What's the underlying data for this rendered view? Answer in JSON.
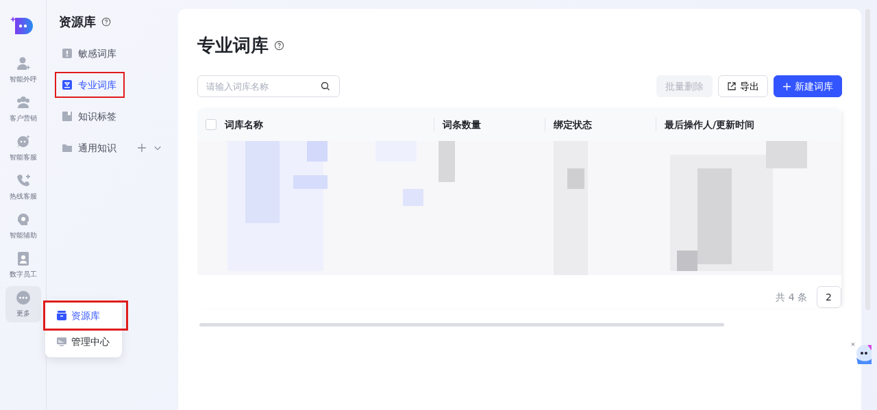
{
  "rail": {
    "items": [
      {
        "label": "智能外呼",
        "selected": false
      },
      {
        "label": "客户营销",
        "selected": false
      },
      {
        "label": "智能客服",
        "selected": false
      },
      {
        "label": "热线客服",
        "selected": false
      },
      {
        "label": "智能辅助",
        "selected": false
      },
      {
        "label": "数字员工",
        "selected": false
      },
      {
        "label": "更多",
        "selected": true
      }
    ]
  },
  "popup_menu": {
    "items": [
      {
        "label": "资源库",
        "selected": true,
        "highlighted": true
      },
      {
        "label": "管理中心",
        "selected": false,
        "highlighted": false
      }
    ]
  },
  "sidebar": {
    "title": "资源库",
    "items": [
      {
        "label": "敏感词库",
        "selected": false,
        "highlighted": false
      },
      {
        "label": "专业词库",
        "selected": true,
        "highlighted": true
      },
      {
        "label": "知识标签",
        "selected": false,
        "highlighted": false
      },
      {
        "label": "通用知识",
        "selected": false,
        "highlighted": false,
        "expandable": true
      }
    ]
  },
  "page": {
    "title": "专业词库",
    "search": {
      "placeholder": "请输入词库名称"
    },
    "buttons": [
      {
        "label": "批量删除",
        "kind": "disabled"
      },
      {
        "label": "导出",
        "kind": "export"
      },
      {
        "label": "新建词库",
        "kind": "primary"
      }
    ],
    "table": {
      "select_all": {
        "checked": false
      },
      "columns": [
        "词库名称",
        "词条数量",
        "绑定状态",
        "最后操作人/更新时间"
      ]
    },
    "pagination": {
      "total": "共 4 条",
      "page_size": "2"
    }
  }
}
